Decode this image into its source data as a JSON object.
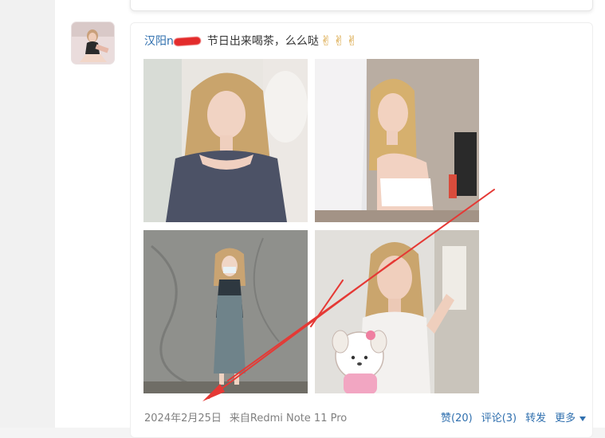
{
  "post": {
    "username": "汉阳n",
    "text": "节日出来喝茶，么么哒",
    "emojis": [
      "✌",
      "✌",
      "✌"
    ],
    "date": "2024年2月25日",
    "source": "来自Redmi Note 11 Pro",
    "actions": {
      "like": "赞(20)",
      "comment": "评论(3)",
      "repost": "转发",
      "more": "更多"
    }
  },
  "colors": {
    "link": "#2f6fae",
    "annotation_arrow": "#e53935",
    "redaction": "#e32b2b"
  }
}
